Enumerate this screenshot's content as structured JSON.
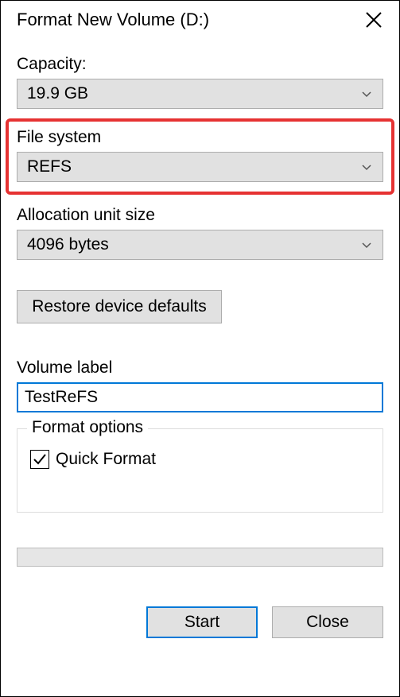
{
  "window": {
    "title": "Format New Volume (D:)"
  },
  "capacity": {
    "label": "Capacity:",
    "value": "19.9 GB"
  },
  "filesystem": {
    "label": "File system",
    "value": "REFS"
  },
  "allocation": {
    "label": "Allocation unit size",
    "value": "4096 bytes"
  },
  "restore_label": "Restore device defaults",
  "volume_label": {
    "label": "Volume label",
    "value": "TestReFS"
  },
  "format_options": {
    "title": "Format options",
    "quick_format_label": "Quick Format",
    "quick_format_checked": true
  },
  "buttons": {
    "start": "Start",
    "close": "Close"
  }
}
